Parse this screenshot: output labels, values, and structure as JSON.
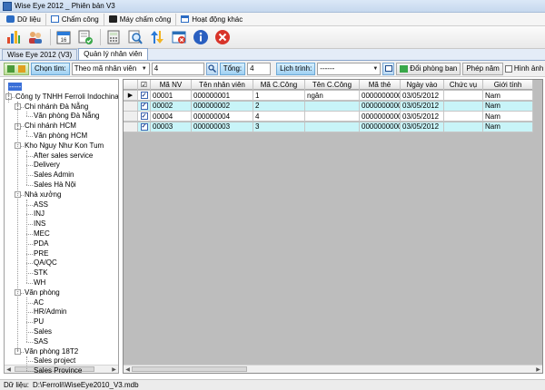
{
  "window": {
    "title": "Wise Eye 2012 _ Phiên bản V3"
  },
  "menu": [
    {
      "label": "Dữ liệu",
      "icon": "database-icon",
      "color": "#2b6cc4"
    },
    {
      "label": "Chấm công",
      "icon": "timesheet-icon",
      "color": "#2b6cc4"
    },
    {
      "label": "Máy chấm công",
      "icon": "device-icon",
      "color": "#222222"
    },
    {
      "label": "Hoạt động khác",
      "icon": "window-icon",
      "color": "#2b6cc4"
    }
  ],
  "toolbar": [
    {
      "name": "chart-icon"
    },
    {
      "name": "users-icon"
    },
    {
      "name": "calendar-icon"
    },
    {
      "name": "approve-icon"
    },
    {
      "name": "calculator-icon"
    },
    {
      "name": "search-icon"
    },
    {
      "name": "sync-icon"
    },
    {
      "name": "close-window-icon"
    },
    {
      "name": "info-icon"
    },
    {
      "name": "exit-icon"
    }
  ],
  "tabs": [
    {
      "label": "Wise Eye 2012 (V3)",
      "active": false
    },
    {
      "label": "Quản lý nhân viên",
      "active": true
    }
  ],
  "filter": {
    "search_label": "Chọn tìm:",
    "search_by": "Theo mã nhân viên",
    "search_value": "4",
    "total_label": "Tổng:",
    "total_value": "4",
    "schedule_label": "Lịch trình:",
    "schedule_value": "------",
    "transfer_button": "Đổi phòng ban",
    "leave_button": "Phép năm",
    "photo_label": "Hình ảnh"
  },
  "tree": {
    "root_label": "-----",
    "nodes": [
      {
        "label": "Công ty TNHH Ferroli Indochina",
        "level": 0,
        "toggle": "-"
      },
      {
        "label": "Chi nhánh Đà Nẵng",
        "level": 1,
        "toggle": "-"
      },
      {
        "label": "Văn phòng Đà Nẵng",
        "level": 2,
        "toggle": ""
      },
      {
        "label": "Chi nhánh HCM",
        "level": 1,
        "toggle": "-"
      },
      {
        "label": "Văn phòng HCM",
        "level": 2,
        "toggle": ""
      },
      {
        "label": "Kho Nguy Như Kon Tum",
        "level": 1,
        "toggle": "-"
      },
      {
        "label": "After sales service",
        "level": 2,
        "toggle": ""
      },
      {
        "label": "Delivery",
        "level": 2,
        "toggle": ""
      },
      {
        "label": "Sales Admin",
        "level": 2,
        "toggle": ""
      },
      {
        "label": "Sales Hà Nội",
        "level": 2,
        "toggle": ""
      },
      {
        "label": "Nhà xưởng",
        "level": 1,
        "toggle": "-"
      },
      {
        "label": "ASS",
        "level": 2,
        "toggle": ""
      },
      {
        "label": "INJ",
        "level": 2,
        "toggle": ""
      },
      {
        "label": "INS",
        "level": 2,
        "toggle": ""
      },
      {
        "label": "MEC",
        "level": 2,
        "toggle": ""
      },
      {
        "label": "PDA",
        "level": 2,
        "toggle": ""
      },
      {
        "label": "PRE",
        "level": 2,
        "toggle": ""
      },
      {
        "label": "QA/QC",
        "level": 2,
        "toggle": ""
      },
      {
        "label": "STK",
        "level": 2,
        "toggle": ""
      },
      {
        "label": "WH",
        "level": 2,
        "toggle": ""
      },
      {
        "label": "Văn phòng",
        "level": 1,
        "toggle": "-"
      },
      {
        "label": "AC",
        "level": 2,
        "toggle": ""
      },
      {
        "label": "HR/Admin",
        "level": 2,
        "toggle": ""
      },
      {
        "label": "PU",
        "level": 2,
        "toggle": ""
      },
      {
        "label": "Sales",
        "level": 2,
        "toggle": ""
      },
      {
        "label": "SAS",
        "level": 2,
        "toggle": ""
      },
      {
        "label": "Văn phòng 18T2",
        "level": 1,
        "toggle": "-"
      },
      {
        "label": "Sales project",
        "level": 2,
        "toggle": ""
      },
      {
        "label": "Sales Province",
        "level": 2,
        "toggle": ""
      }
    ]
  },
  "grid": {
    "columns": [
      {
        "label": ""
      },
      {
        "label": "☑"
      },
      {
        "label": "Mã NV"
      },
      {
        "label": "Tên nhân viên"
      },
      {
        "label": "Mã C.Công"
      },
      {
        "label": "Tên C.Công"
      },
      {
        "label": "Mã thẻ"
      },
      {
        "label": "Ngày vào"
      },
      {
        "label": "Chức vụ"
      },
      {
        "label": "Giới tính"
      }
    ],
    "rows": [
      {
        "indicator": "▶",
        "checked": true,
        "ma_nv": "00001",
        "ten_nv": "000000001",
        "ma_cc": "1",
        "ten_cc": "ngân",
        "ma_the": "0000000000",
        "ngay_vao": "03/05/2012",
        "chuc_vu": "",
        "gioi_tinh": "Nam"
      },
      {
        "indicator": "",
        "checked": true,
        "ma_nv": "00002",
        "ten_nv": "000000002",
        "ma_cc": "2",
        "ten_cc": "",
        "ma_the": "0000000000",
        "ngay_vao": "03/05/2012",
        "chuc_vu": "",
        "gioi_tinh": "Nam"
      },
      {
        "indicator": "",
        "checked": true,
        "ma_nv": "00004",
        "ten_nv": "000000004",
        "ma_cc": "4",
        "ten_cc": "",
        "ma_the": "0000000000",
        "ngay_vao": "03/05/2012",
        "chuc_vu": "",
        "gioi_tinh": "Nam"
      },
      {
        "indicator": "",
        "checked": true,
        "ma_nv": "00003",
        "ten_nv": "000000003",
        "ma_cc": "3",
        "ten_cc": "",
        "ma_the": "0000000000",
        "ngay_vao": "03/05/2012",
        "chuc_vu": "",
        "gioi_tinh": "Nam"
      }
    ]
  },
  "status": {
    "label": "Dữ liệu:",
    "path": "D:\\Ferroli\\WiseEye2010_V3.mdb"
  }
}
